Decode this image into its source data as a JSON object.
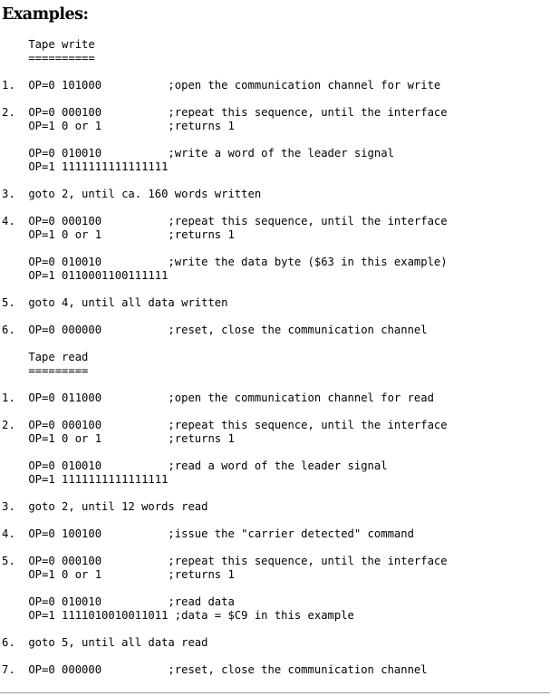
{
  "heading": "Examples:",
  "lines": [
    "    Tape write",
    "    ==========",
    "",
    "1.  OP=0 101000          ;open the communication channel for write",
    "",
    "2.  OP=0 000100          ;repeat this sequence, until the interface",
    "    OP=1 0 or 1          ;returns 1",
    "",
    "    OP=0 010010          ;write a word of the leader signal",
    "    OP=1 1111111111111111",
    "",
    "3.  goto 2, until ca. 160 words written",
    "",
    "4.  OP=0 000100          ;repeat this sequence, until the interface",
    "    OP=1 0 or 1          ;returns 1",
    "",
    "    OP=0 010010          ;write the data byte ($63 in this example)",
    "    OP=1 0110001100111111",
    "",
    "5.  goto 4, until all data written",
    "",
    "6.  OP=0 000000          ;reset, close the communication channel",
    "",
    "    Tape read",
    "    =========",
    "",
    "1.  OP=0 011000          ;open the communication channel for read",
    "",
    "2.  OP=0 000100          ;repeat this sequence, until the interface",
    "    OP=1 0 or 1          ;returns 1",
    "",
    "    OP=0 010010          ;read a word of the leader signal",
    "    OP=1 1111111111111111",
    "",
    "3.  goto 2, until 12 words read",
    "",
    "4.  OP=0 100100          ;issue the \"carrier detected\" command",
    "",
    "5.  OP=0 000100          ;repeat this sequence, until the interface",
    "    OP=1 0 or 1          ;returns 1",
    "",
    "    OP=0 010010          ;read data",
    "    OP=1 1111010010011011 ;data = $C9 in this example",
    "",
    "6.  goto 5, until all data read",
    "",
    "7.  OP=0 000000          ;reset, close the communication channel"
  ]
}
